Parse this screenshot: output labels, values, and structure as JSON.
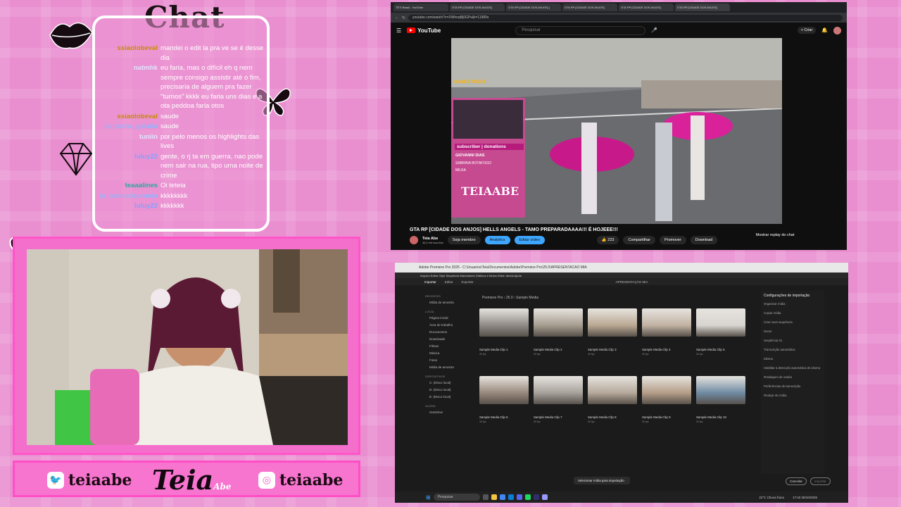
{
  "chat": {
    "title": "Chat",
    "messages": [
      {
        "user": "ssiaolobeval",
        "text": "mandei o edit la pra ve se é desse dia",
        "color": "#c98a00"
      },
      {
        "user": "natmhk",
        "text": "eu faria, mas o difícil eh q nem sempre consigo assistir até o fim, precisaria de alguem pra fazer \"turnos\" kkkk eu faria uns dias e a ota peddoa faria otos",
        "color": "#e3e3ff"
      },
      {
        "user": "ssiaolobeval",
        "text": "saude",
        "color": "#c98a00"
      },
      {
        "user": "lu_tocha_gelada",
        "text": "saude",
        "color": "#8fb6ff"
      },
      {
        "user": "tuniin",
        "text": "por pelo menos os highlights das lives",
        "color": "#e3e3ff"
      },
      {
        "user": "luluy22",
        "text": "gente, o rj ta em guerra, nao pode nem sair na rua, tipo uma noite de crime",
        "color": "#7fa3ff"
      },
      {
        "user": "teaaalines",
        "text": "Oi teteia",
        "color": "#2ca8a0"
      },
      {
        "user": "lu_memodepronta",
        "text": "kkkkkkkk",
        "color": "#8fb6ff"
      },
      {
        "user": "luluy22",
        "text": "kkkkkkk",
        "color": "#7fa3ff"
      }
    ]
  },
  "footer": {
    "twitter": "teiaabe",
    "instagram": "teiaabe",
    "brand": "Teia",
    "brand_sub": "Abe"
  },
  "browser": {
    "tabs": [
      "TETI Brasil - YouTube",
      "GTA RP [CIDADE DOS ANJOS]",
      "GTA RP [CIDADE DOS ANJOS] |",
      "GTA RP [CIDADE DOS ANJOS]",
      "GTA RP [CIDADE DOS ANJOS]",
      "GTA RP [CIDADE DOS ANJOS]"
    ],
    "url": "youtube.com/watch?v=XWhoqBj0GPs&t=11989s",
    "yt_logo": "YouTube",
    "search_placeholder": "Pesquisar",
    "create_label": "+ Criar",
    "video_title": "GTA RP [CIDADE DOS ANJOS] HELLS ANGELS - TAMO PREPARADAAAA!!! É HOJEEE!!!",
    "channel_name": "Teia Abe",
    "subscribers": "36,4 mil inscritos",
    "members_label": "Seja membro",
    "analytics_label": "Analytics",
    "edit_label": "Editar vídeo",
    "likes": "223",
    "share_label": "Compartilhar",
    "promote_label": "Promover",
    "download_label": "Download",
    "chat_replay": "Mostrar replay do chat",
    "overlay": {
      "subscribe": "subscriber | donations",
      "donor1": "GIOVANNI DIAS",
      "donor2": "SABRINA BOTAFOGO",
      "donor3": "MILKA",
      "streamer": "TEIAABE",
      "games": "GAMES PRIZES"
    }
  },
  "premiere": {
    "title": "Adobe Premiere Pro 2025 - C:\\Usuarios\\Teia\\Documentos\\Adobe\\Premiere Pro\\25.0\\APRESENTACAO MIA",
    "menus": "Arquivo  Editar  Clipe  Sequência  Marcadores  Gráficos e títulos  Exibir  Janela  Ajuda",
    "tabs": [
      "Importar",
      "Editar",
      "Exportar"
    ],
    "center_title": "APRESENTAÇÃO MIA",
    "breadcrumb": "Premiere Pro  ›  25.0  ›  Sample Media",
    "sidebar": {
      "recent_head": "RECENTES",
      "recent": [
        "Mídia de amostra"
      ],
      "local_head": "LOCAL",
      "local": [
        "Página inicial",
        "Área de trabalho",
        "Documentos",
        "Downloads",
        "Filmes",
        "Música",
        "Fotos",
        "Mídia de amostra"
      ],
      "devices_head": "DISPOSITIVOS",
      "devices": [
        "C: (Disco local)",
        "D: (Disco local)",
        "E: (Disco local)"
      ],
      "cloud_head": "NUVEM",
      "cloud": [
        "OneDrive"
      ]
    },
    "clips": [
      {
        "name": "Sample Media Clip 1",
        "meta": "30 fps"
      },
      {
        "name": "Sample Media Clip 2",
        "meta": "30 fps"
      },
      {
        "name": "Sample Media Clip 3",
        "meta": "30 fps"
      },
      {
        "name": "Sample Media Clip 4",
        "meta": "30 fps"
      },
      {
        "name": "Sample Media Clip 5",
        "meta": "30 fps"
      },
      {
        "name": "Sample Media Clip 6",
        "meta": "30 fps"
      },
      {
        "name": "Sample Media Clip 7",
        "meta": "30 fps"
      },
      {
        "name": "Sample Media Clip 8",
        "meta": "30 fps"
      },
      {
        "name": "Sample Media Clip 9",
        "meta": "30 fps"
      },
      {
        "name": "Sample Media Clip 10",
        "meta": "30 fps"
      }
    ],
    "right_panel": {
      "title": "Configurações de importação",
      "items": [
        "Organizar mídia",
        "Copiar mídia",
        "Criar nova sequência",
        "Nome",
        "Sequência 01",
        "Transcrição automática",
        "Idioma",
        "Habilitar a detecção automática de idioma",
        "Rotulagem de orador",
        "Preferências de transcrição",
        "Realçar de mídia"
      ]
    },
    "toast": "Selecionar mídia para importação",
    "cancel_label": "Cancelar",
    "import_label": "Importar",
    "taskbar_search": "Pesquisar",
    "weather": "22°C  Chuva fraca",
    "clock": "17:43",
    "date": "28/10/2025"
  }
}
